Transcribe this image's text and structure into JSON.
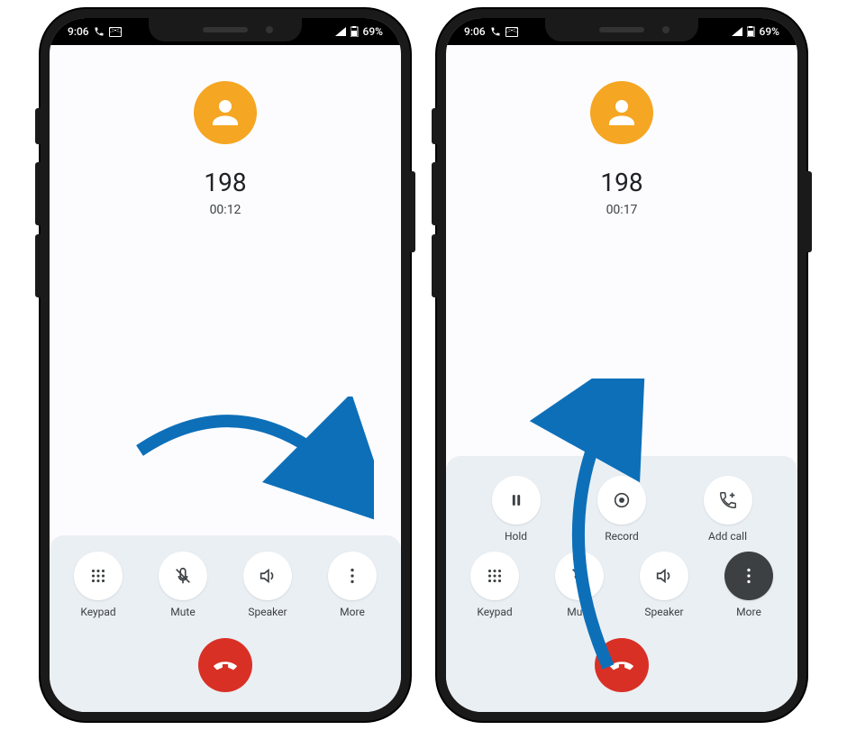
{
  "status": {
    "time": "9:06",
    "battery": "69%"
  },
  "colors": {
    "accent": "#f5a623",
    "hangup": "#d93025",
    "arrow": "#0d6fb8"
  },
  "phone1": {
    "number": "198",
    "duration": "00:12",
    "buttons": [
      {
        "name": "keypad",
        "label": "Keypad",
        "icon": "keypad"
      },
      {
        "name": "mute",
        "label": "Mute",
        "icon": "mute"
      },
      {
        "name": "speaker",
        "label": "Speaker",
        "icon": "speaker"
      },
      {
        "name": "more",
        "label": "More",
        "icon": "more"
      }
    ]
  },
  "phone2": {
    "number": "198",
    "duration": "00:17",
    "top_buttons": [
      {
        "name": "hold",
        "label": "Hold",
        "icon": "hold"
      },
      {
        "name": "record",
        "label": "Record",
        "icon": "record"
      },
      {
        "name": "add-call",
        "label": "Add call",
        "icon": "addcall"
      }
    ],
    "bottom_buttons": [
      {
        "name": "keypad",
        "label": "Keypad",
        "icon": "keypad"
      },
      {
        "name": "mute",
        "label": "Mute",
        "icon": "mute"
      },
      {
        "name": "speaker",
        "label": "Speaker",
        "icon": "speaker"
      },
      {
        "name": "more",
        "label": "More",
        "icon": "more",
        "dark": true
      }
    ]
  }
}
